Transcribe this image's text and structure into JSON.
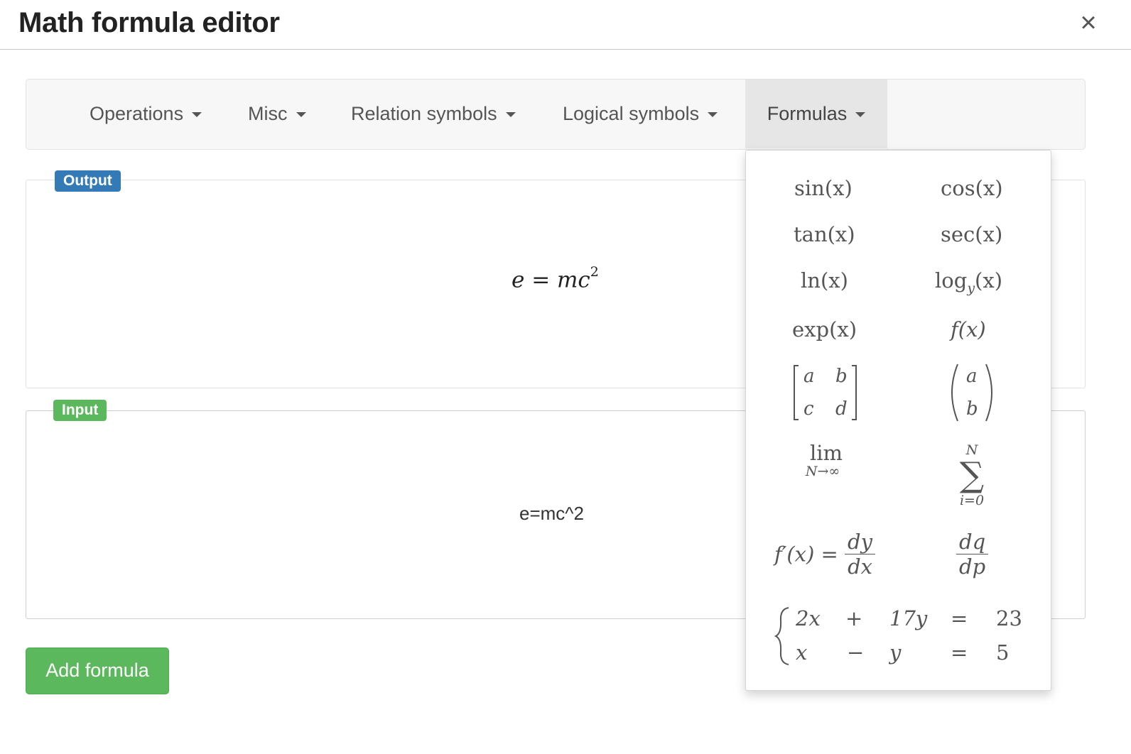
{
  "dialog": {
    "title": "Math formula editor",
    "close_glyph": "×"
  },
  "toolbar": {
    "menus": [
      {
        "label": "Operations"
      },
      {
        "label": "Misc"
      },
      {
        "label": "Relation symbols"
      },
      {
        "label": "Logical symbols"
      },
      {
        "label": "Formulas",
        "active": true
      }
    ]
  },
  "output": {
    "badge": "Output",
    "formula_base": "e = mc",
    "formula_exp": "2"
  },
  "input": {
    "badge": "Input",
    "value": "e=mc^2"
  },
  "actions": {
    "add_label": "Add formula"
  },
  "formulas_menu": {
    "sin": "sin(x)",
    "cos": "cos(x)",
    "tan": "tan(x)",
    "sec": "sec(x)",
    "ln": "ln(x)",
    "log": {
      "base": "log",
      "sub": "y",
      "arg": "(x)"
    },
    "exp": "exp(x)",
    "func": "f(x)",
    "matrix": [
      "a",
      "b",
      "c",
      "d"
    ],
    "binom": [
      "a",
      "b"
    ],
    "limit": {
      "op": "lim",
      "under": "N→∞"
    },
    "sum": {
      "op": "∑",
      "upper": "N",
      "lower": "i=0"
    },
    "derivative": {
      "lhs": "f′(x) =",
      "num": "dy",
      "den": "dx"
    },
    "partial": {
      "num": "dq",
      "den": "dp"
    },
    "system": [
      [
        "2x",
        "+",
        "17y",
        "=",
        "23"
      ],
      [
        "x",
        "−",
        "y",
        "=",
        "5"
      ]
    ]
  },
  "colors": {
    "output_badge": "#337ab7",
    "input_badge": "#5cb85c",
    "add_button": "#5cb85c"
  }
}
